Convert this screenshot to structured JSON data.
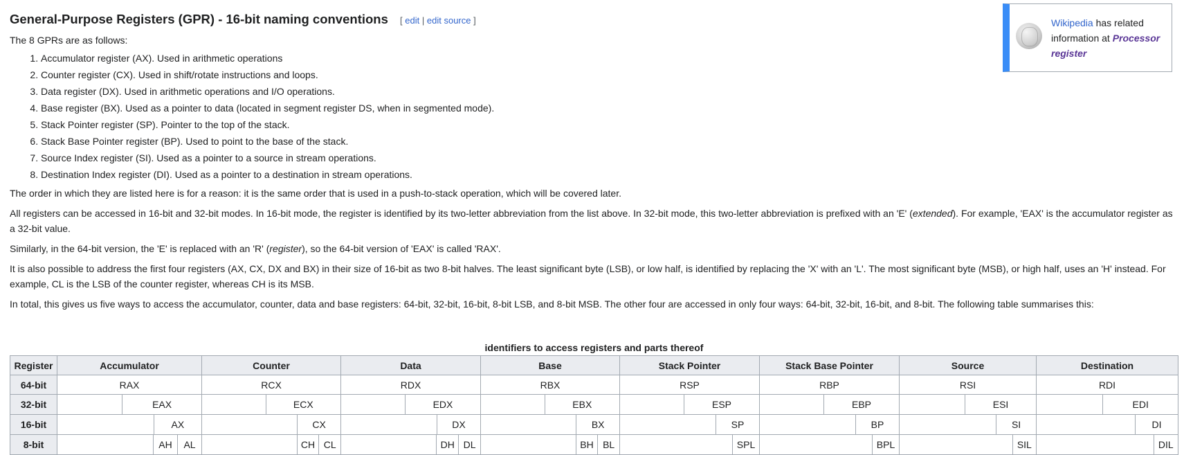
{
  "section": {
    "title": "General-Purpose Registers (GPR) - 16-bit naming conventions",
    "edit_open": "[",
    "edit": "edit",
    "sep": "|",
    "edit_source": "edit source",
    "edit_close": "]"
  },
  "sidebox": {
    "link": "Wikipedia",
    "text": "has related information at",
    "article": "Processor register"
  },
  "intro": "The 8 GPRs are as follows:",
  "list": [
    "Accumulator register (AX). Used in arithmetic operations",
    "Counter register (CX). Used in shift/rotate instructions and loops.",
    "Data register (DX). Used in arithmetic operations and I/O operations.",
    "Base register (BX). Used as a pointer to data (located in segment register DS, when in segmented mode).",
    "Stack Pointer register (SP). Pointer to the top of the stack.",
    "Stack Base Pointer register (BP). Used to point to the base of the stack.",
    "Source Index register (SI). Used as a pointer to a source in stream operations.",
    "Destination Index register (DI). Used as a pointer to a destination in stream operations."
  ],
  "para1": "The order in which they are listed here is for a reason: it is the same order that is used in a push-to-stack operation, which will be covered later.",
  "para2a": "All registers can be accessed in 16-bit and 32-bit modes. In 16-bit mode, the register is identified by its two-letter abbreviation from the list above. In 32-bit mode, this two-letter abbreviation is prefixed with an 'E' (",
  "para2em": "extended",
  "para2b": "). For example, 'EAX' is the accumulator register as a 32-bit value.",
  "para3a": "Similarly, in the 64-bit version, the 'E' is replaced with an 'R' (",
  "para3em": "register",
  "para3b": "), so the 64-bit version of 'EAX' is called 'RAX'.",
  "para4": "It is also possible to address the first four registers (AX, CX, DX and BX) in their size of 16-bit as two 8-bit halves. The least significant byte (LSB), or low half, is identified by replacing the 'X' with an 'L'. The most significant byte (MSB), or high half, uses an 'H' instead. For example, CL is the LSB of the counter register, whereas CH is its MSB.",
  "para5": "In total, this gives us five ways to access the accumulator, counter, data and base registers: 64-bit, 32-bit, 16-bit, 8-bit LSB, and 8-bit MSB. The other four are accessed in only four ways: 64-bit, 32-bit, 16-bit, and 8-bit. The following table summarises this:",
  "table": {
    "caption": "identifiers to access registers and parts thereof",
    "corner": "Register",
    "columns": [
      "Accumulator",
      "Counter",
      "Data",
      "Base",
      "Stack Pointer",
      "Stack Base Pointer",
      "Source",
      "Destination"
    ],
    "rows": {
      "r64": {
        "label": "64-bit",
        "cells": [
          "RAX",
          "RCX",
          "RDX",
          "RBX",
          "RSP",
          "RBP",
          "RSI",
          "RDI"
        ]
      },
      "r32": {
        "label": "32-bit",
        "cells": [
          "EAX",
          "ECX",
          "EDX",
          "EBX",
          "ESP",
          "EBP",
          "ESI",
          "EDI"
        ]
      },
      "r16": {
        "label": "16-bit",
        "cells": [
          "AX",
          "CX",
          "DX",
          "BX",
          "SP",
          "BP",
          "SI",
          "DI"
        ]
      },
      "r8": {
        "label": "8-bit",
        "cells": [
          [
            "AH",
            "AL"
          ],
          [
            "CH",
            "CL"
          ],
          [
            "DH",
            "DL"
          ],
          [
            "BH",
            "BL"
          ],
          [
            "SPL"
          ],
          [
            "BPL"
          ],
          [
            "SIL"
          ],
          [
            "DIL"
          ]
        ]
      }
    }
  }
}
